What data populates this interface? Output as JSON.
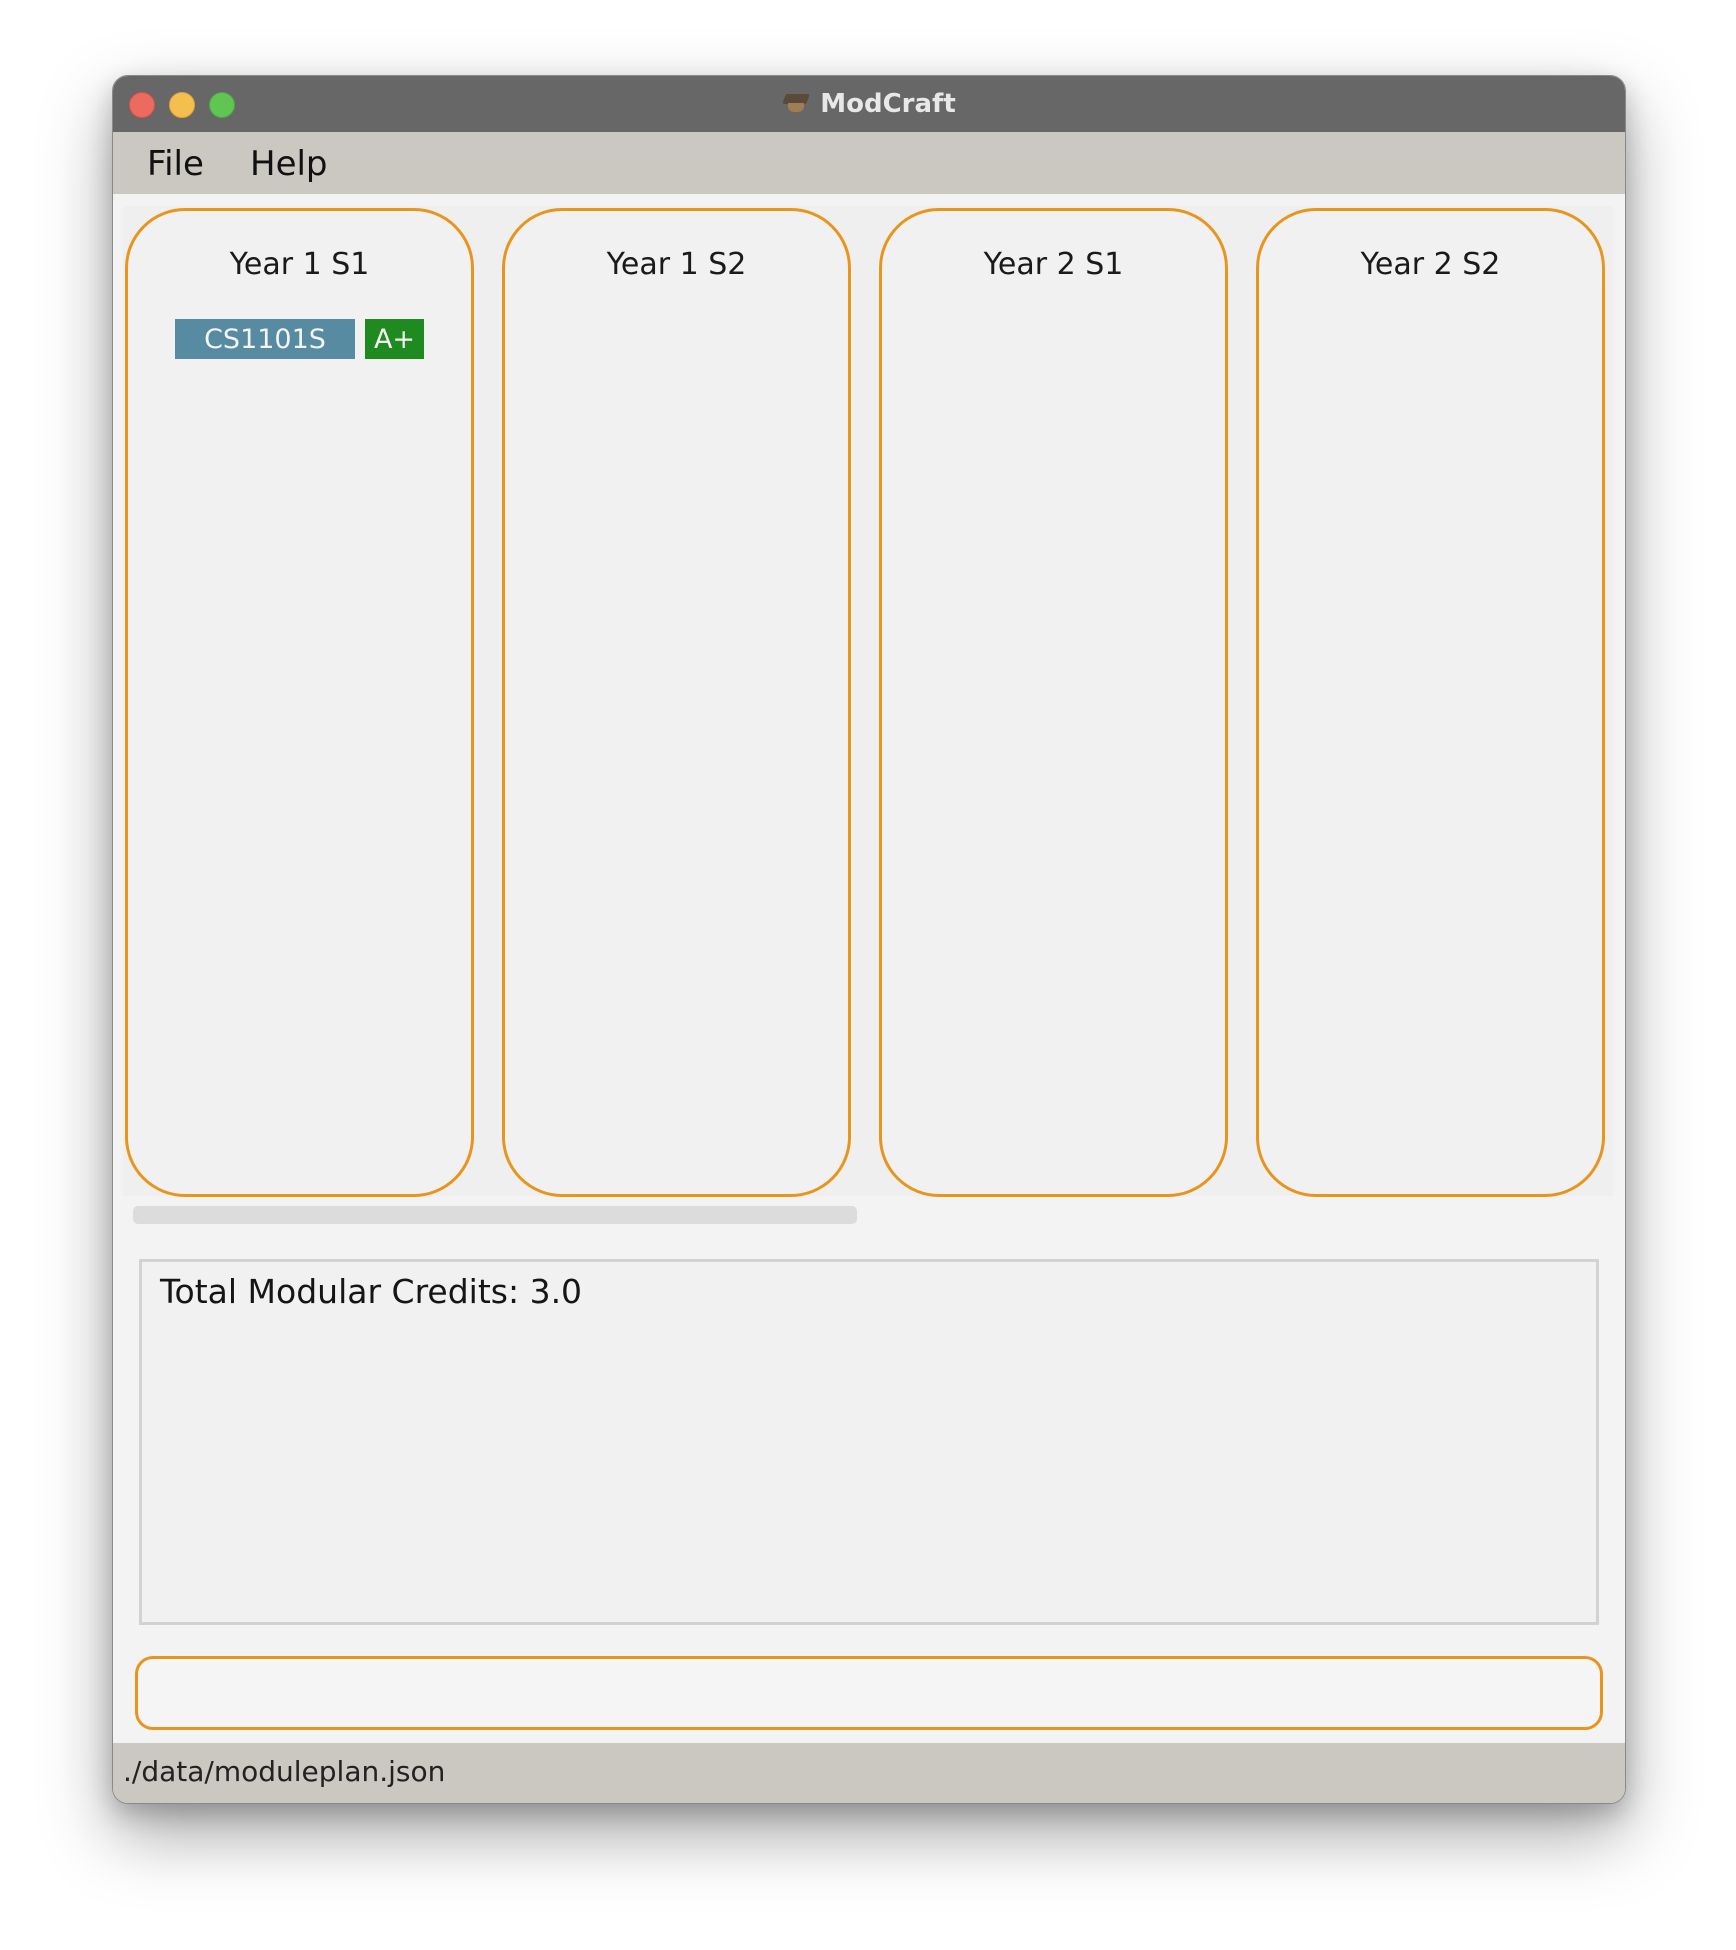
{
  "window": {
    "title": "ModCraft",
    "app_icon": "graduation-cap-icon"
  },
  "menu": {
    "file_label": "File",
    "help_label": "Help"
  },
  "semesters": [
    {
      "title": "Year 1 S1",
      "modules": [
        {
          "code": "CS1101S",
          "grade": "A+"
        }
      ]
    },
    {
      "title": "Year 1 S2",
      "modules": []
    },
    {
      "title": "Year 2 S1",
      "modules": []
    },
    {
      "title": "Year 2 S2",
      "modules": []
    }
  ],
  "result": {
    "text": "Total Modular Credits: 3.0"
  },
  "command": {
    "value": "",
    "placeholder": ""
  },
  "status": {
    "file_path": "./data/moduleplan.json"
  },
  "colors": {
    "accent": "#e8951e",
    "module_code_bg": "#568ba1",
    "grade_bg": "#1f8a1f",
    "titlebar": "#676767",
    "menubar": "#cbc8c1"
  }
}
